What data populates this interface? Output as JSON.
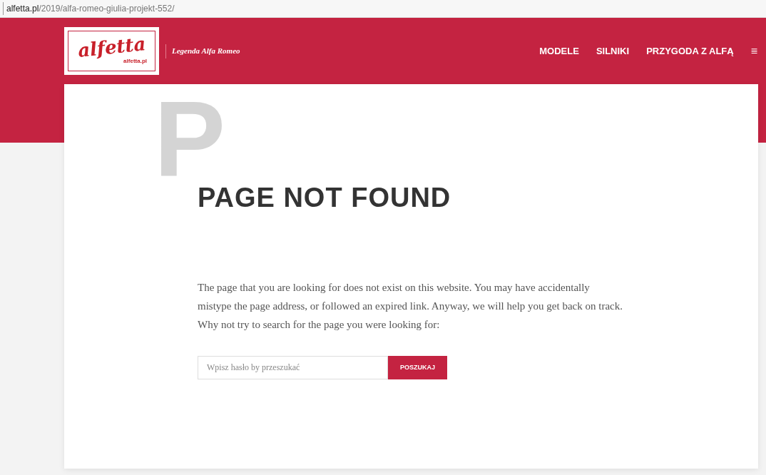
{
  "address_bar": {
    "domain": "alfetta.pl",
    "path": "/2019/alfa-romeo-giulia-projekt-552/"
  },
  "header": {
    "logo": {
      "script": "alfetta",
      "small": "alfetta.pl"
    },
    "tagline": "Legenda Alfa Romeo",
    "nav": [
      "MODELE",
      "SILNIKI",
      "PRZYGODA Z ALFĄ"
    ],
    "menu_glyph": "≡"
  },
  "content": {
    "backdrop_letter": "P",
    "title": "PAGE NOT FOUND",
    "message": "The page that you are looking for does not exist on this website. You may have accidentally mistype the page address, or followed an expired link. Anyway, we will help you get back on track. Why not try to search for the page you were looking for:",
    "search": {
      "placeholder": "Wpisz hasło by przeszukać",
      "button": "POSZUKAJ"
    }
  }
}
